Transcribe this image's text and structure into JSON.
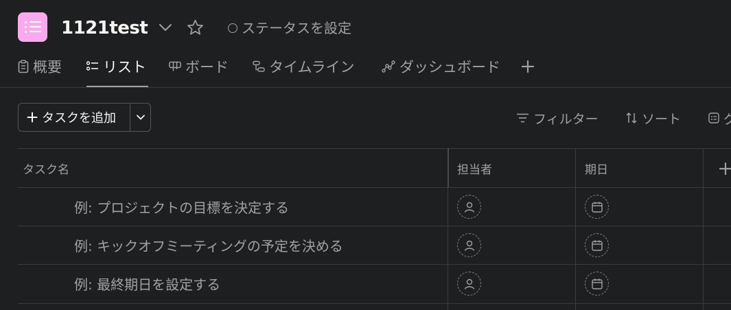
{
  "project": {
    "title": "1121test",
    "status_label": "ステータスを設定",
    "icon_color": "#f9aaef"
  },
  "tabs": [
    {
      "label": "概要",
      "icon": "clipboard-icon",
      "active": false
    },
    {
      "label": "リスト",
      "icon": "list-icon",
      "active": true
    },
    {
      "label": "ボード",
      "icon": "board-icon",
      "active": false
    },
    {
      "label": "タイムライン",
      "icon": "timeline-icon",
      "active": false
    },
    {
      "label": "ダッシュボード",
      "icon": "dashboard-icon",
      "active": false
    }
  ],
  "toolbar": {
    "add_task_label": "タスクを追加",
    "filter_label": "フィルター",
    "sort_label": "ソート",
    "group_label_partial": "グ"
  },
  "table": {
    "columns": [
      "タスク名",
      "担当者",
      "期日"
    ],
    "rows": [
      {
        "name": "例: プロジェクトの目標を決定する"
      },
      {
        "name": "例: キックオフミーティングの予定を決める"
      },
      {
        "name": "例: 最終期日を設定する"
      }
    ]
  },
  "colors": {
    "background": "#1e1f21",
    "text_primary": "#f5f4f3",
    "text_secondary": "#a2a0a2",
    "border": "#3c3c3e"
  }
}
